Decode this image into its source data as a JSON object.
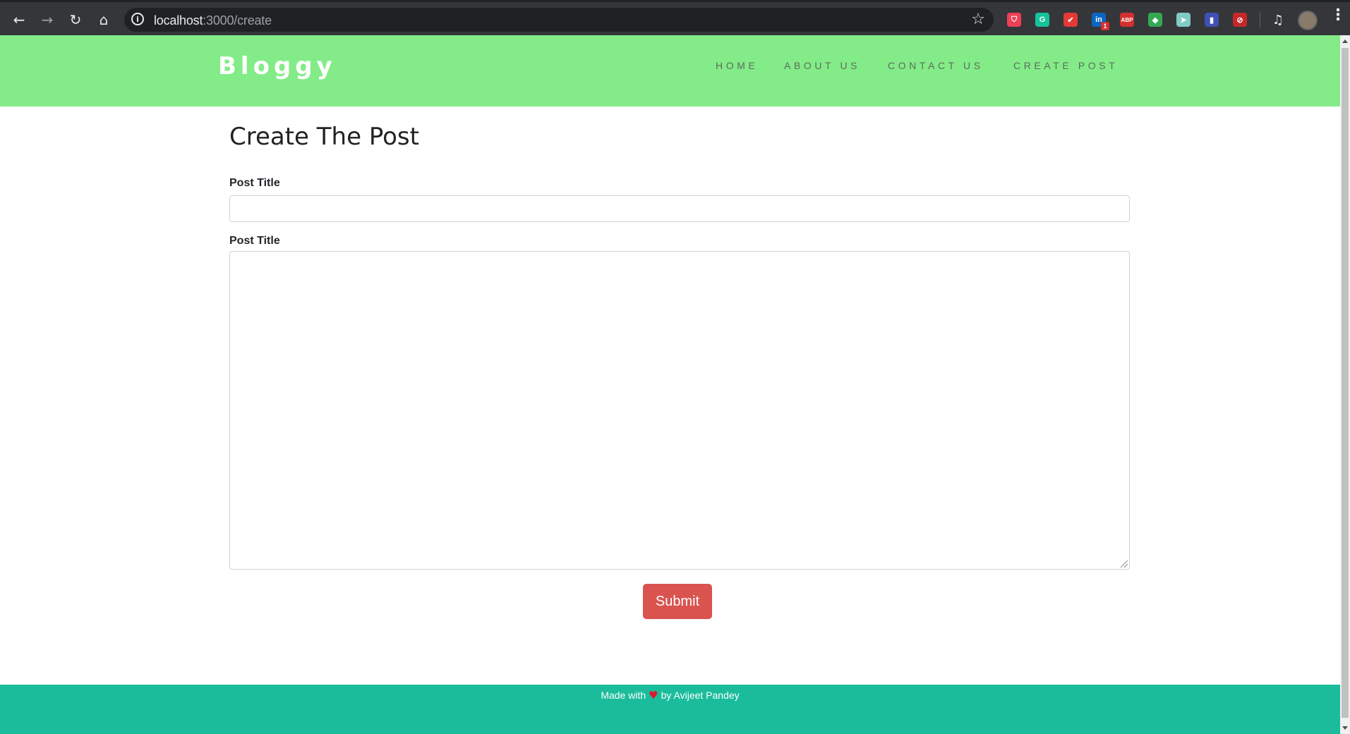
{
  "browser": {
    "url_host": "localhost",
    "url_path": ":3000/create",
    "extensions": [
      {
        "icon": "pocket-icon",
        "glyph": "⛉",
        "color": "#ef4056"
      },
      {
        "icon": "grammarly-icon",
        "glyph": "G",
        "color": "#15c39a"
      },
      {
        "icon": "extension-red-icon",
        "glyph": "✔",
        "color": "#e53935"
      },
      {
        "icon": "linkedin-icon",
        "glyph": "in",
        "color": "#0a66c2",
        "badge": "1"
      },
      {
        "icon": "adblock-plus-icon",
        "glyph": "ABP",
        "color": "#d32f2f"
      },
      {
        "icon": "google-drive-icon",
        "glyph": "◆",
        "color": "#34a853"
      },
      {
        "icon": "send-icon",
        "glyph": "➤",
        "color": "#80cbc4"
      },
      {
        "icon": "extension-flag-icon",
        "glyph": "▮",
        "color": "#3f51b5"
      },
      {
        "icon": "blocked-icon",
        "glyph": "⊘",
        "color": "#c62828"
      }
    ]
  },
  "site": {
    "brand": "Bloggy",
    "nav": [
      "HOME",
      "ABOUT US",
      "CONTACT US",
      "CREATE POST"
    ]
  },
  "form": {
    "heading": "Create The Post",
    "title_label": "Post Title",
    "title_value": "",
    "content_label": "Post Title",
    "content_value": "",
    "submit_label": "Submit"
  },
  "footer": {
    "prefix": "Made with",
    "suffix": "by Avijeet Pandey"
  },
  "colors": {
    "header_bg": "#83ec88",
    "footer_bg": "#1abc9c",
    "submit_bg": "#d9534f"
  }
}
